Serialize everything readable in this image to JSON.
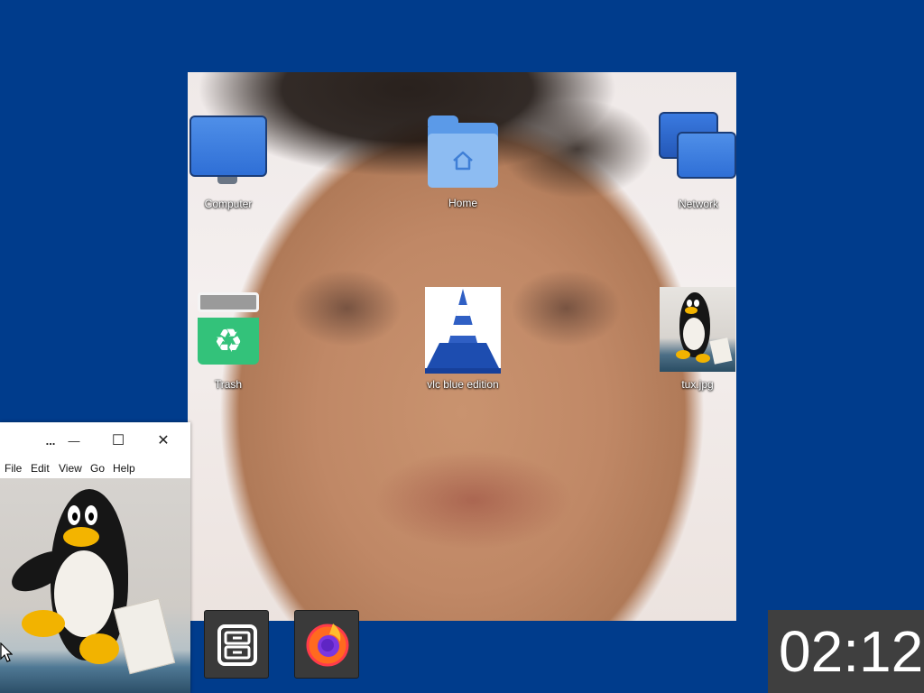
{
  "desktop": {
    "background_color": "#003c8c",
    "icons": [
      {
        "id": "computer",
        "label": "Computer",
        "icon": "computer-icon"
      },
      {
        "id": "home",
        "label": "Home",
        "icon": "home-folder-icon"
      },
      {
        "id": "network",
        "label": "Network",
        "icon": "network-icon"
      },
      {
        "id": "trash",
        "label": "Trash",
        "icon": "trash-icon"
      },
      {
        "id": "vlc",
        "label": "vlc blue edition",
        "icon": "vlc-cone-icon"
      },
      {
        "id": "tux",
        "label": "tux.jpg",
        "icon": "image-thumbnail-icon"
      }
    ]
  },
  "viewer_window": {
    "title": "...",
    "controls": {
      "minimize": "—",
      "maximize": "☐",
      "close": "✕"
    },
    "menu": [
      "File",
      "Edit",
      "View",
      "Go",
      "Help"
    ],
    "content": "tux penguin photo"
  },
  "taskbar": {
    "buttons": [
      {
        "id": "file-manager",
        "icon": "file-cabinet-icon"
      },
      {
        "id": "firefox",
        "icon": "firefox-icon"
      }
    ],
    "clock": "02:12"
  },
  "colors": {
    "accent": "#5b9ae8",
    "trash_green": "#33c27a",
    "taskbar_bg": "#3a3a3a"
  }
}
